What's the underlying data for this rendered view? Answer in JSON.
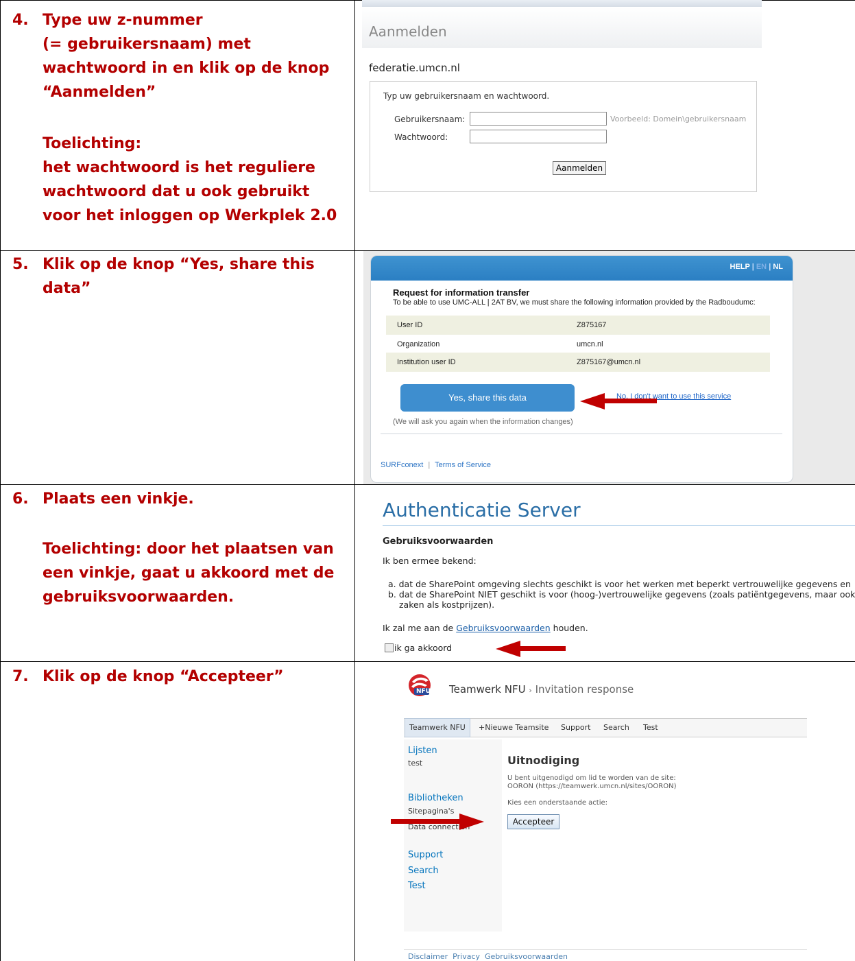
{
  "steps": [
    {
      "number": "4.",
      "lines": [
        "Type uw z-nummer",
        "(= gebruikersnaam) met",
        "wachtwoord in en klik op de knop",
        "“Aanmelden”"
      ],
      "note_heading": "Toelichting:",
      "note_lines": [
        "het wachtwoord is het reguliere",
        "wachtwoord dat u ook gebruikt",
        "voor het inloggen op Werkplek 2.0"
      ]
    },
    {
      "number": "5.",
      "lines": [
        "Klik op de knop “Yes, share this",
        "data”"
      ]
    },
    {
      "number": "6.",
      "lines": [
        "Plaats een vinkje."
      ],
      "note_lines": [
        "Toelichting: door het plaatsen van",
        "een vinkje, gaat u akkoord met de",
        "gebruiksvoorwaarden."
      ]
    },
    {
      "number": "7.",
      "lines": [
        "Klik op de knop “Accepteer”"
      ]
    }
  ],
  "adfs": {
    "title": "Aanmelden",
    "domain": "federatie.umcn.nl",
    "intro": "Typ uw gebruikersnaam en wachtwoord.",
    "username_label": "Gebruikersnaam:",
    "password_label": "Wachtwoord:",
    "username_hint": "Voorbeeld: Domein\\gebruikersnaam",
    "submit": "Aanmelden"
  },
  "surf": {
    "lang_help": "HELP",
    "lang_sep1": "|",
    "lang_en": "EN",
    "lang_sep2": "|",
    "lang_nl": "NL",
    "heading": "Request for information transfer",
    "intro": "To be able to use UMC-ALL | 2AT BV, we must share the following information provided by the Radboudumc:",
    "rows": [
      {
        "key": "User ID",
        "value": "Z875167"
      },
      {
        "key": "Organization",
        "value": "umcn.nl"
      },
      {
        "key": "Institution user ID",
        "value": "Z875167@umcn.nl"
      }
    ],
    "accept": "Yes, share this data",
    "decline": "No, I don't want to use this service",
    "footnote": "(We will ask you again when the information changes)",
    "footer_brand": "SURFconext",
    "footer_sep": "|",
    "footer_tos": "Terms of Service"
  },
  "auth": {
    "title": "Authenticatie Server",
    "heading": "Gebruiksvoorwaarden",
    "intro": "Ik ben ermee bekend:",
    "item_a": "a.  dat de SharePoint omgeving slechts geschikt is voor het werken met beperkt vertrouwelijke gegevens en",
    "item_b": "b.  dat de SharePoint NIET geschikt is voor (hoog-)vertrouwelijke gegevens (zoals patiëntgegevens, maar ook bedrijfsg",
    "item_b2": "zaken als kostprijzen).",
    "pledge_pre": "Ik zal me aan de ",
    "pledge_link": "Gebruiksvoorwaarden",
    "pledge_post": " houden.",
    "checkbox_label": "ik ga akkoord"
  },
  "sp": {
    "logo_text": "NFU",
    "site": "Teamwerk NFU",
    "breadcrumb_sep": "›",
    "page": "Invitation response",
    "tabs": [
      "Teamwerk NFU",
      "+Nieuwe Teamsite",
      "Support",
      "Search",
      "Test"
    ],
    "left": {
      "lists": "Lijsten",
      "lists_item": "test",
      "libraries": "Bibliotheken",
      "lib_item1": "Sitepagina's",
      "lib_item2": "Data connection",
      "support": "Support",
      "search": "Search",
      "test": "Test"
    },
    "heading": "Uitnodiging",
    "invite_line1": "U bent uitgenodigd om lid te worden van de site:",
    "invite_line2": "OORON (https://teamwerk.umcn.nl/sites/OORON)",
    "choose": "Kies een onderstaande actie:",
    "accept": "Accepteer",
    "footer": [
      "Disclaimer",
      "Privacy",
      "Gebruiksvoorwaarden"
    ]
  },
  "colors": {
    "step_text": "#b30000",
    "arrow": "#c00000",
    "surf_blue": "#3e8ecf",
    "sp_link": "#0072bc"
  }
}
